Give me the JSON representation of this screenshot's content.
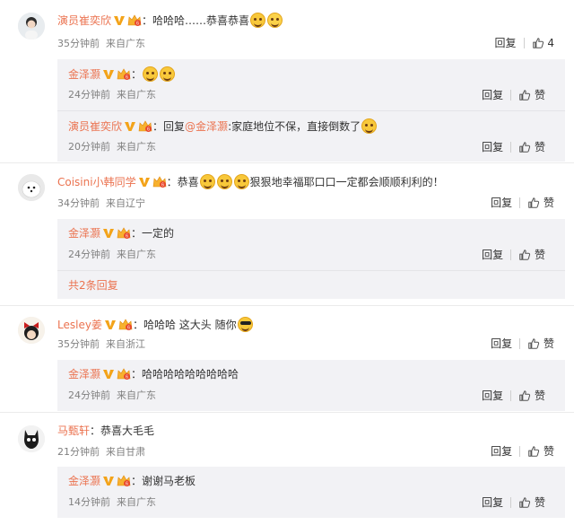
{
  "threads": [
    {
      "author": "演员崔奕欣",
      "text": "哈哈哈……恭喜恭喜",
      "time": "35分钟前",
      "source": "来自广东",
      "reply_label": "回复",
      "like_count": "4",
      "replies": [
        {
          "author": "金泽灏",
          "text": "",
          "time": "24分钟前",
          "source": "来自广东",
          "reply_label": "回复",
          "like_label": "赞"
        },
        {
          "author": "演员崔奕欣",
          "reply_prefix": "回复",
          "mention": "@金泽灏",
          "text": ":家庭地位不保，直接倒数了",
          "time": "20分钟前",
          "source": "来自广东",
          "reply_label": "回复",
          "like_label": "赞"
        }
      ]
    },
    {
      "author": "Coisini小韩同学",
      "text_before": "恭喜",
      "text_after": "狠狠地幸福耶口口一定都会顺顺利利的！",
      "time": "34分钟前",
      "source": "来自辽宁",
      "reply_label": "回复",
      "like_label": "赞",
      "replies": [
        {
          "author": "金泽灏",
          "text": "一定的",
          "time": "24分钟前",
          "source": "来自广东",
          "reply_label": "回复",
          "like_label": "赞"
        }
      ],
      "more_replies": "共2条回复"
    },
    {
      "author": "Lesley姜",
      "text": "哈哈哈 这大头 随你",
      "time": "35分钟前",
      "source": "来自浙江",
      "reply_label": "回复",
      "like_label": "赞",
      "replies": [
        {
          "author": "金泽灏",
          "text": "哈哈哈哈哈哈哈哈哈",
          "time": "24分钟前",
          "source": "来自广东",
          "reply_label": "回复",
          "like_label": "赞"
        }
      ]
    },
    {
      "author": "马甄轩",
      "text": "恭喜大毛毛",
      "time": "21分钟前",
      "source": "来自甘肃",
      "reply_label": "回复",
      "like_label": "赞",
      "replies": [
        {
          "author": "金泽灏",
          "text": "谢谢马老板",
          "time": "14分钟前",
          "source": "来自广东",
          "reply_label": "回复",
          "like_label": "赞"
        }
      ]
    }
  ],
  "icons": {
    "verified": "verified-v-icon",
    "vip": "vip-crown-icon",
    "like": "thumb-up-icon"
  },
  "colors": {
    "username": "#eb7350",
    "meta": "#808080",
    "reply_bg": "#f2f2f5"
  }
}
